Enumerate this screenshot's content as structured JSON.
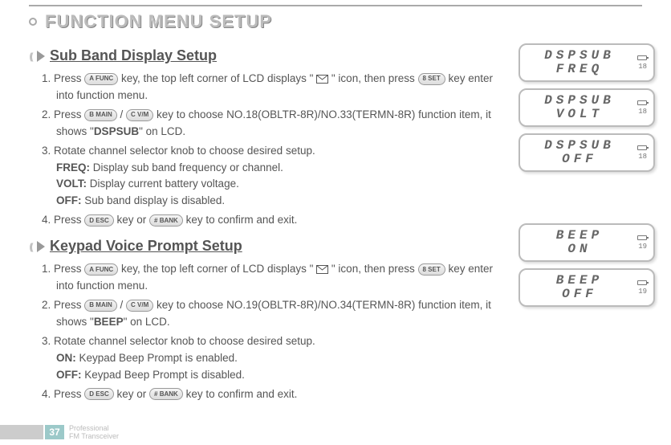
{
  "header": {
    "title": "FUNCTION MENU SETUP"
  },
  "sections": [
    {
      "title": "Sub Band Display Setup",
      "steps": {
        "s1a": "1. Press ",
        "s1b": " key, the top left corner of LCD displays \" ",
        "s1c": " \"  icon, then press ",
        "s1d": " key enter into function menu.",
        "s2a": "2. Press ",
        "s2b": " / ",
        "s2c": " key to choose NO.18(OBLTR-8R)/NO.33(TERMN-8R) function item, it shows \"",
        "s2d": "DSPSUB",
        "s2e": "\" on LCD.",
        "s3": "3. Rotate channel selector knob to choose desired setup.",
        "o1l": "FREQ:",
        "o1r": " Display sub band frequency or channel.",
        "o2l": "VOLT:",
        "o2r": " Display current battery voltage.",
        "o3l": "OFF:",
        "o3r": " Sub band display is disabled.",
        "s4a": "4. Press ",
        "s4b": " key or ",
        "s4c": " key to confirm and exit."
      }
    },
    {
      "title": "Keypad Voice Prompt Setup",
      "steps": {
        "s1a": "1. Press ",
        "s1b": " key, the top left corner of LCD displays \" ",
        "s1c": " \" icon, then press ",
        "s1d": " key enter into function menu.",
        "s2a": "2. Press ",
        "s2b": " / ",
        "s2c": " key to choose NO.19(OBLTR-8R)/NO.34(TERMN-8R) function item, it shows \"",
        "s2d": "BEEP",
        "s2e": "\" on LCD.",
        "s3": "3. Rotate channel selector knob to choose desired setup.",
        "o1l": "ON:",
        "o1r": " Keypad Beep Prompt  is enabled.",
        "o2l": "OFF:",
        "o2r": " Keypad Beep Prompt is disabled.",
        "s4a": "4. Press ",
        "s4b": " key or ",
        "s4c": " key to confirm and exit."
      }
    }
  ],
  "keys": {
    "func": "A FUNC",
    "set": "8 SET",
    "main": "B MAIN",
    "vm": "C V/M",
    "esc": "D ESC",
    "bank": "# BANK"
  },
  "lcds": [
    {
      "l1": "DSPSUB",
      "l2": "FREQ",
      "num": "18"
    },
    {
      "l1": "DSPSUB",
      "l2": "VOLT",
      "num": "18"
    },
    {
      "l1": "DSPSUB",
      "l2": "OFF",
      "num": "18"
    },
    {
      "l1": "BEEP",
      "l2": "ON",
      "num": "19"
    },
    {
      "l1": "BEEP",
      "l2": "OFF",
      "num": "19"
    }
  ],
  "footer": {
    "page": "37",
    "brand1": "Professional",
    "brand2": "FM Transceiver"
  }
}
